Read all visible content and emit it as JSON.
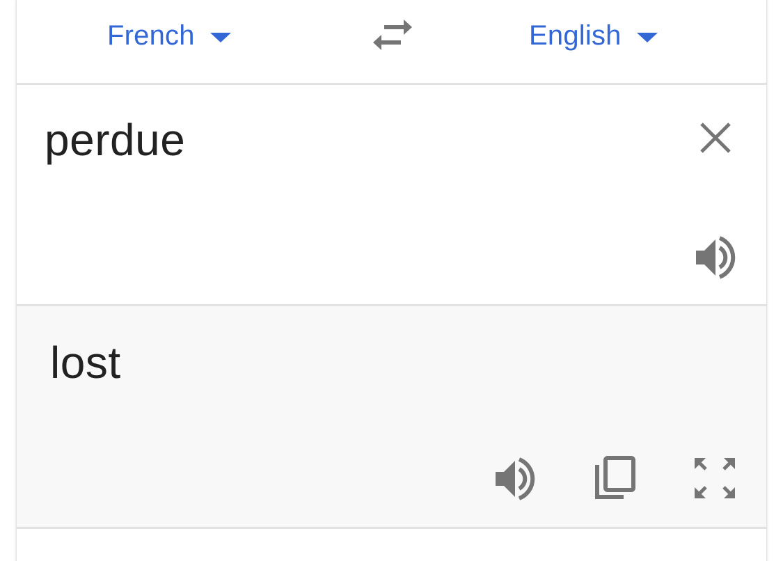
{
  "language_bar": {
    "source_language": "French",
    "target_language": "English",
    "swap_icon": "swap-arrows-icon",
    "caret_icon": "caret-down-icon"
  },
  "source_panel": {
    "text": "perdue",
    "clear_icon": "close-icon",
    "listen_icon": "speaker-icon"
  },
  "result_panel": {
    "text": "lost",
    "listen_icon": "speaker-icon",
    "copy_icon": "copy-icon",
    "fullscreen_icon": "fullscreen-icon"
  },
  "colors": {
    "accent": "#3367d6",
    "icon": "#757575",
    "text": "#222222",
    "result_background": "#f8f8f8",
    "divider": "#e2e2e2"
  }
}
